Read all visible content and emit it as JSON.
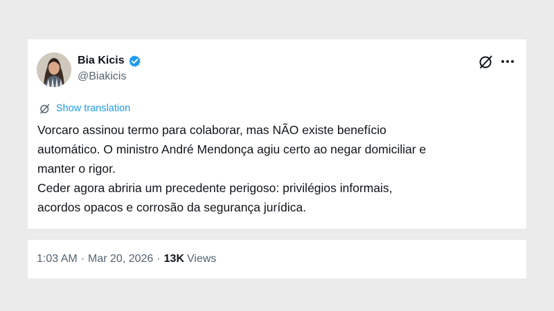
{
  "author": {
    "name": "Bia Kicis",
    "handle": "@Biakicis",
    "verified": true,
    "verified_color": "#1d9bf0"
  },
  "icons": {
    "grok": "grok-icon",
    "more": "more-icon",
    "translate": "translate-icon",
    "verified": "verified-badge-icon"
  },
  "translation": {
    "label": "Show translation"
  },
  "tweet": {
    "lines": [
      "Vorcaro assinou termo para colaborar, mas NÃO existe benefício",
      "automático. O ministro André Mendonça agiu certo ao negar domiciliar e",
      "manter o rigor.",
      "Ceder agora abriria um precedente perigoso: privilégios informais,",
      "acordos opacos e corrosão da segurança jurídica."
    ]
  },
  "meta": {
    "time": "1:03 AM",
    "separator": "·",
    "date": "Mar 20, 2026",
    "views_count": "13K",
    "views_label": "Views"
  },
  "colors": {
    "background": "#ebebeb",
    "card": "#ffffff",
    "text_primary": "#0f1419",
    "text_secondary": "#536471",
    "accent": "#1d9bf0"
  }
}
